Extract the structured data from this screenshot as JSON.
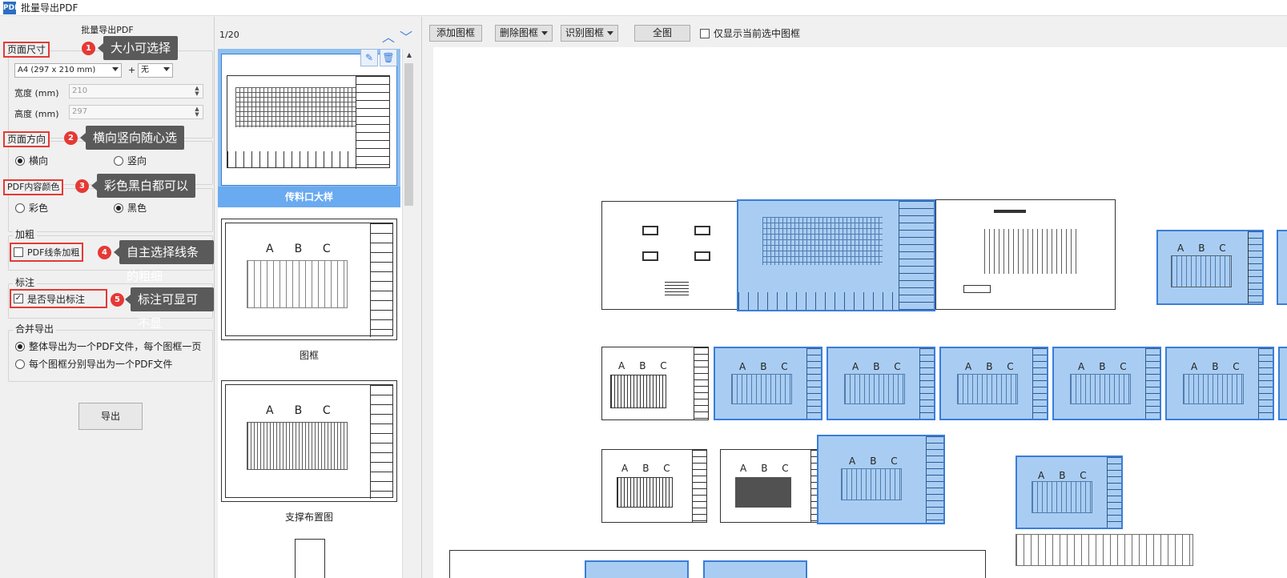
{
  "window": {
    "title": "批量导出PDF",
    "icon_label": "PDF"
  },
  "left": {
    "panel_title": "批量导出PDF",
    "page_size": {
      "label": "页面尺寸",
      "size_select": "A4 (297 x 210 mm)",
      "plus": "+",
      "margin_select": "无",
      "width_label": "宽度 (mm)",
      "width_value": "210",
      "height_label": "高度 (mm)",
      "height_value": "297"
    },
    "orientation": {
      "label": "页面方向",
      "landscape": "横向",
      "portrait": "竖向",
      "selected": "横向"
    },
    "color": {
      "label": "PDF内容颜色",
      "color_option": "彩色",
      "bw_option": "黑色",
      "selected": "黑色"
    },
    "bold": {
      "label": "加粗",
      "checkbox_label": "PDF线条加粗",
      "checked": false
    },
    "annotation": {
      "label": "标注",
      "checkbox_label": "是否导出标注",
      "checked": true
    },
    "merge": {
      "label": "合并导出",
      "option_single": "整体导出为一个PDF文件，每个图框一页",
      "option_multi": "每个图框分别导出为一个PDF文件",
      "selected": "single"
    },
    "export_button": "导出",
    "badges": [
      "1",
      "2",
      "3",
      "4",
      "5"
    ],
    "callouts": [
      "大小可选择",
      "横向竖向随心选",
      "彩色黑白都可以",
      "自主选择线条的粗细",
      "标注可显可不显"
    ]
  },
  "thumbs": {
    "page_indicator": "1/20",
    "items": [
      {
        "caption": "传料口大样"
      },
      {
        "caption": "图框"
      },
      {
        "caption": "支撑布置图"
      }
    ]
  },
  "toolbar": {
    "add_frame": "添加图框",
    "delete_frame": "删除图框",
    "recognize_frame": "识别图框",
    "full_view": "全图",
    "only_selected": "仅显示当前选中图框"
  },
  "colors": {
    "accent": "#3b7dd8",
    "highlight_red": "#e53935",
    "callout_bg": "#5a5a5a",
    "selected_fill": "#a9cdf2"
  }
}
